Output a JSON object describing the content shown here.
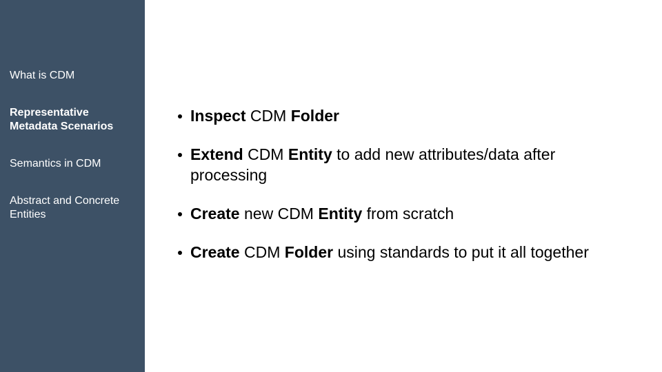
{
  "sidebar": {
    "items": [
      {
        "label": "What is CDM",
        "active": false
      },
      {
        "label": "Representative Metadata Scenarios",
        "active": true
      },
      {
        "label": "Semantics in CDM",
        "active": false
      },
      {
        "label": "Abstract and Concrete Entities",
        "active": false
      }
    ]
  },
  "main": {
    "bullets": [
      {
        "parts": [
          {
            "text": "Inspect",
            "bold": true
          },
          {
            "text": " CDM ",
            "bold": false
          },
          {
            "text": "Folder",
            "bold": true
          }
        ]
      },
      {
        "parts": [
          {
            "text": "Extend",
            "bold": true
          },
          {
            "text": " CDM ",
            "bold": false
          },
          {
            "text": "Entity",
            "bold": true
          },
          {
            "text": " to add new attributes/data after processing",
            "bold": false
          }
        ]
      },
      {
        "parts": [
          {
            "text": "Create",
            "bold": true
          },
          {
            "text": " new CDM ",
            "bold": false
          },
          {
            "text": "Entity",
            "bold": true
          },
          {
            "text": " from scratch",
            "bold": false
          }
        ]
      },
      {
        "parts": [
          {
            "text": "Create",
            "bold": true
          },
          {
            "text": " CDM ",
            "bold": false
          },
          {
            "text": "Folder",
            "bold": true
          },
          {
            "text": " using standards to put it all together",
            "bold": false
          }
        ]
      }
    ]
  }
}
